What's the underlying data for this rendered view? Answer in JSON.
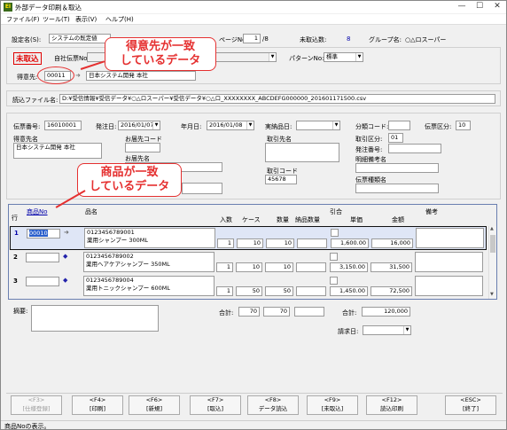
{
  "window": {
    "app_icon": "EI",
    "title": "外部データ印刷＆取込",
    "min_icon": "—",
    "max_icon": "☐",
    "close_icon": "✕"
  },
  "menu": [
    {
      "label": "ファイル(F)"
    },
    {
      "label": "ツール(T)"
    },
    {
      "label": "表示(V)"
    },
    {
      "label": "ヘルプ(H)"
    }
  ],
  "settings": {
    "label": "設定名(S):",
    "value": "システムの既定値",
    "page_label": "ページNo:",
    "page_value": "1",
    "page_total": "/8",
    "pending_label": "未取込数:",
    "pending_value": "8",
    "group_label": "グループ名:",
    "group_value": "○△ロスーパー"
  },
  "header": {
    "badge": "未取込",
    "own_slip_label": "自社伝票No:",
    "pattern_label": "パターンNo:",
    "pattern_value": "標準",
    "customer_label": "得意先:",
    "customer_code": "00011",
    "customer_name": "日本システム開発 本社"
  },
  "callouts": {
    "customer": "得意先が一致\nしているデータ",
    "product": "商品が一致\nしているデータ"
  },
  "file": {
    "label": "読込ファイル名:",
    "value": "D:¥受信情報¥受信データ¥○△ロスーパー¥受信データ¥○△ロ_XXXXXXXX_ABCDEFG000000_201601171500.csv"
  },
  "slip": {
    "number_label": "伝票番号:",
    "number_value": "16010001",
    "order_date_label": "発注日:",
    "order_date_value": "2016/01/07",
    "annual_date_label": "年月日:",
    "annual_date_value": "2016/01/08",
    "arrival_label": "実納品日:",
    "category_label": "分類コード:",
    "slip_class_label": "伝票区分:",
    "slip_class_value": "10",
    "customer_name_label": "得意先名",
    "customer_name_value": "日本システム開発 本社",
    "delivery_code_label": "お届先コード",
    "delivery_name_label": "お届先名",
    "supplier_name_label": "取引先名",
    "trade_class_label": "取引区分:",
    "trade_class_value": "01",
    "order_number_label": "発注番号:",
    "detail_note_label": "明細備考名",
    "supplier_code_label": "取引コード",
    "supplier_code_value": "45678",
    "slip_type_label": "伝票種類名"
  },
  "grid": {
    "h_row": "行",
    "h_code": "商品No",
    "h_name": "品名",
    "h_entry": "入数",
    "h_case": "ケース",
    "h_qty": "数量",
    "h_deliv_qty": "納品数量",
    "h_discount": "引合",
    "h_unit": "単価",
    "h_amount": "金額",
    "h_note": "備考",
    "rows": [
      {
        "num": "1",
        "code": "00010",
        "jan": "0123456789001",
        "name": "薬用シャンプー 300ML",
        "entry": "1",
        "case": "10",
        "qty": "10",
        "unit": "1,600.00",
        "amount": "16,000"
      },
      {
        "num": "2",
        "code": "",
        "jan": "0123456789002",
        "name": "薬用ヘアケアシャンプー 350ML",
        "entry": "1",
        "case": "10",
        "qty": "10",
        "unit": "3,150.00",
        "amount": "31,500"
      },
      {
        "num": "3",
        "code": "",
        "jan": "0123456789004",
        "name": "薬用トニックシャンプー 600ML",
        "entry": "1",
        "case": "50",
        "qty": "50",
        "unit": "1,450.00",
        "amount": "72,500"
      }
    ]
  },
  "footer": {
    "memo_label": "摘要:",
    "total_label": "合計:",
    "total_entry": "70",
    "total_qty": "70",
    "amount_label": "合計:",
    "amount_value": "120,000",
    "billing_label": "請求日:"
  },
  "fkeys": [
    {
      "key": "<F3>",
      "label": "[仕様登録]",
      "disabled": true
    },
    {
      "key": "<F4>",
      "label": "[印刷]"
    },
    {
      "key": "<F6>",
      "label": "[新規]"
    },
    {
      "key": "<F7>",
      "label": "[取込]"
    },
    {
      "key": "<F8>",
      "label": "データ読込"
    },
    {
      "key": "<F9>",
      "label": "[未取込]"
    },
    {
      "key": "<F12>",
      "label": "読込印刷"
    },
    {
      "key": "<ESC>",
      "label": "[終了]"
    }
  ],
  "status": "商品Noの表示。"
}
